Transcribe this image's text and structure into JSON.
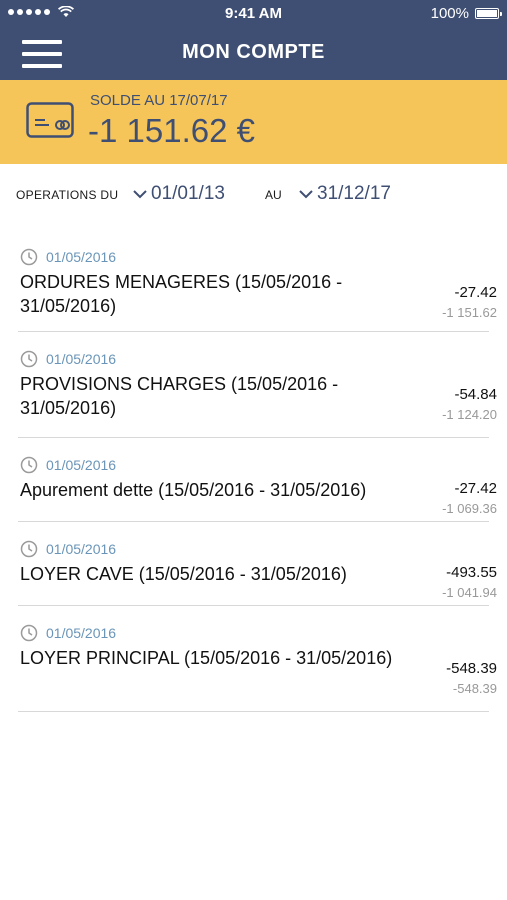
{
  "status_bar": {
    "time": "9:41 AM",
    "battery_text": "100%",
    "icons": [
      "signal-dots-icon",
      "wifi-icon",
      "battery-icon"
    ]
  },
  "nav": {
    "title": "MON COMPTE",
    "menu_icon": "hamburger-menu-icon"
  },
  "balance": {
    "label": "SOLDE AU 17/07/17",
    "value": "-1 151.62 €",
    "icon": "card-icon"
  },
  "filter": {
    "from_label": "OPERATIONS DU",
    "from_date": "01/01/13",
    "to_label": "AU",
    "to_date": "31/12/17",
    "chevron_icon": "chevron-down-icon"
  },
  "colors": {
    "header": "#3f4f73",
    "banner": "#f5c55a",
    "date_accent": "#6a95b8"
  },
  "operations": [
    {
      "date": "01/05/2016",
      "title": "ORDURES MENAGERES (15/05/2016 - 31/05/2016)",
      "amount": "-27.42",
      "balance": "-1 151.62"
    },
    {
      "date": "01/05/2016",
      "title": "PROVISIONS CHARGES (15/05/2016 - 31/05/2016)",
      "amount": "-54.84",
      "balance": "-1 124.20"
    },
    {
      "date": "01/05/2016",
      "title": "Apurement dette (15/05/2016 - 31/05/2016)",
      "amount": "-27.42",
      "balance": "-1 069.36"
    },
    {
      "date": "01/05/2016",
      "title": "LOYER CAVE (15/05/2016 - 31/05/2016)",
      "amount": "-493.55",
      "balance": "-1 041.94"
    },
    {
      "date": "01/05/2016",
      "title": "LOYER PRINCIPAL (15/05/2016 - 31/05/2016)",
      "amount": "-548.39",
      "balance": "-548.39"
    }
  ]
}
